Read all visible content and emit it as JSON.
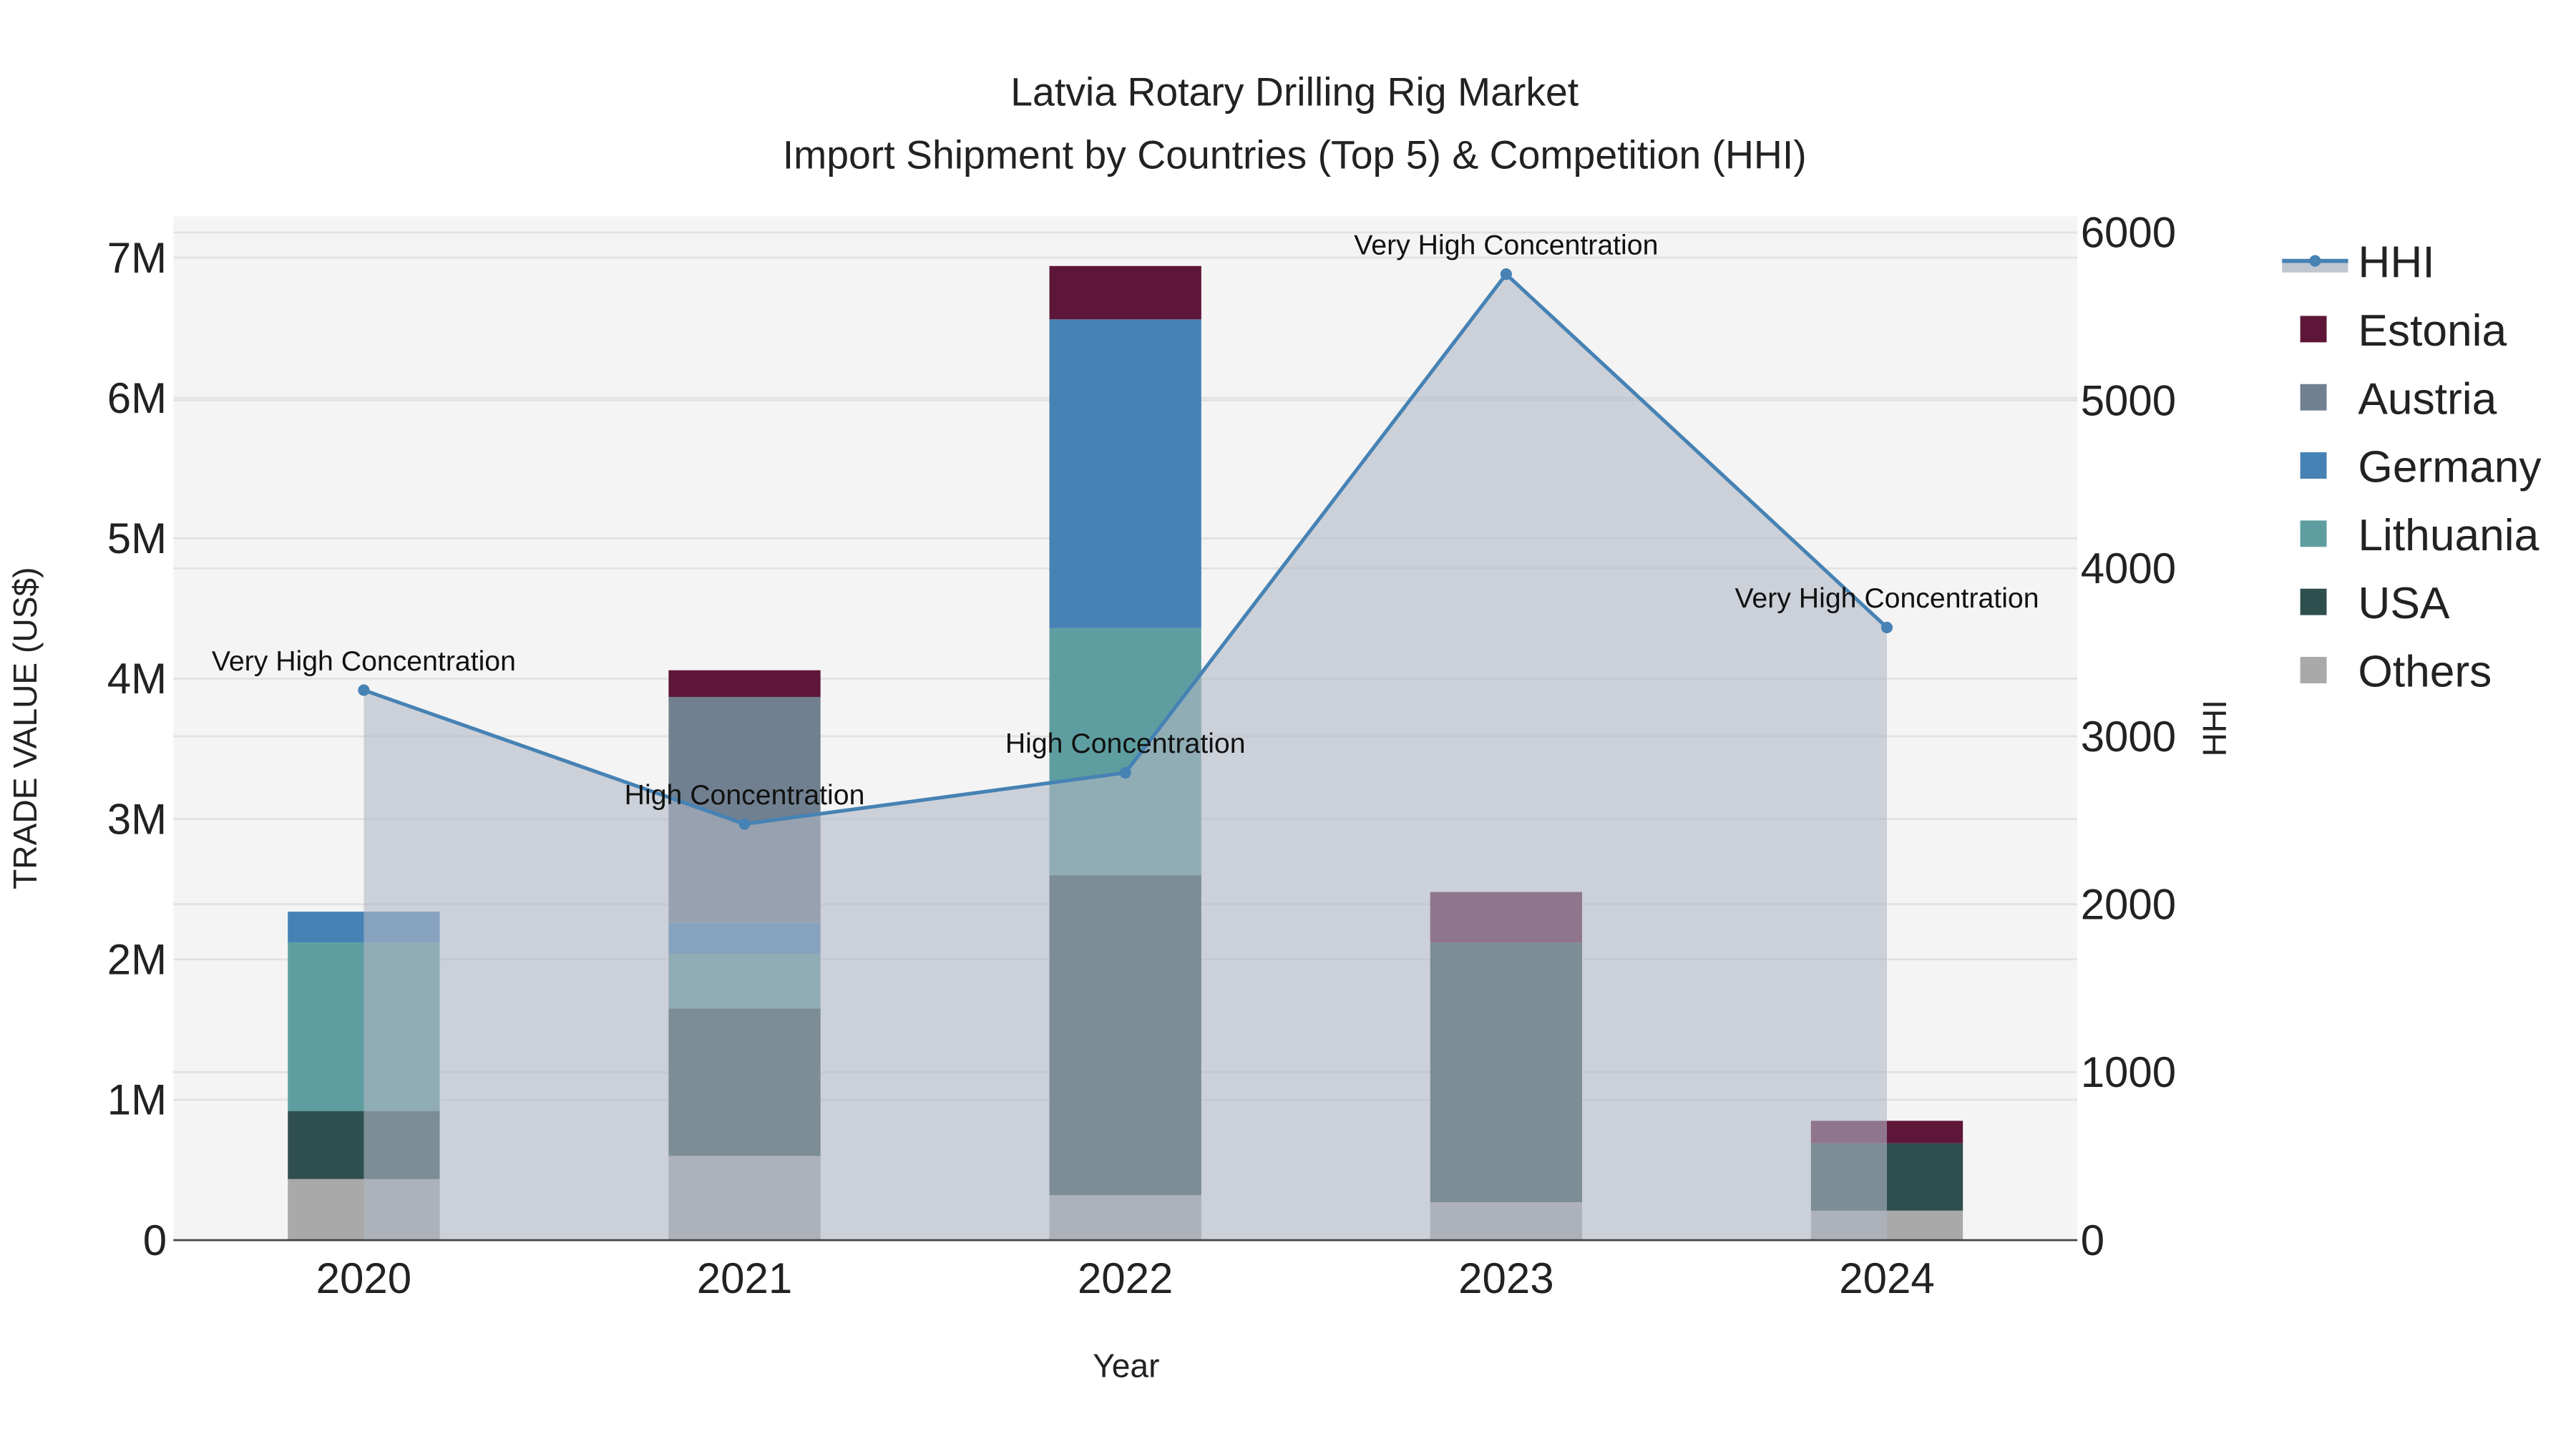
{
  "chart_data": {
    "type": "bar",
    "stacked": true,
    "title": "Latvia Rotary Drilling Rig Market",
    "subtitle": "Import Shipment by Countries (Top 5) & Competition (HHI)",
    "xlabel": "Year",
    "ylabel": "TRADE VALUE (US$)",
    "y2label": "HHI",
    "categories": [
      "2020",
      "2021",
      "2022",
      "2023",
      "2024"
    ],
    "ylim": [
      0,
      7200000
    ],
    "y2lim": [
      0,
      6100
    ],
    "yticks": [
      {
        "v": 0,
        "label": "0"
      },
      {
        "v": 1000000,
        "label": "1M"
      },
      {
        "v": 2000000,
        "label": "2M"
      },
      {
        "v": 3000000,
        "label": "3M"
      },
      {
        "v": 4000000,
        "label": "4M"
      },
      {
        "v": 5000000,
        "label": "5M"
      },
      {
        "v": 6000000,
        "label": "6M"
      },
      {
        "v": 7000000,
        "label": "7M"
      }
    ],
    "y2ticks": [
      {
        "v": 0,
        "label": "0"
      },
      {
        "v": 1000,
        "label": "1000"
      },
      {
        "v": 2000,
        "label": "2000"
      },
      {
        "v": 3000,
        "label": "3000"
      },
      {
        "v": 4000,
        "label": "4000"
      },
      {
        "v": 5000,
        "label": "5000"
      },
      {
        "v": 6000,
        "label": "6000"
      }
    ],
    "grid": true,
    "legend_position": "right",
    "series": [
      {
        "name": "Others",
        "color": "#A9A9A9",
        "values": [
          435000,
          600000,
          320000,
          270000,
          210000
        ]
      },
      {
        "name": "USA",
        "color": "#2F4F4F",
        "values": [
          485000,
          1050000,
          2280000,
          1850000,
          480000
        ]
      },
      {
        "name": "Lithuania",
        "color": "#5F9EA0",
        "values": [
          1200000,
          390000,
          1760000,
          0,
          0
        ]
      },
      {
        "name": "Germany",
        "color": "#4682B4",
        "values": [
          220000,
          220000,
          2200000,
          0,
          0
        ]
      },
      {
        "name": "Austria",
        "color": "#708090",
        "values": [
          0,
          1610000,
          0,
          0,
          0
        ]
      },
      {
        "name": "Estonia",
        "color": "#5E1638",
        "values": [
          0,
          190000,
          380000,
          360000,
          160000
        ]
      }
    ],
    "hhi": {
      "name": "HHI",
      "type": "line+area",
      "color": "#4682B4",
      "fill": "#B0B8C4",
      "values": [
        3275,
        2478,
        2783,
        5752,
        3648
      ],
      "annotations": [
        "Very High Concentration",
        "High Concentration",
        "High Concentration",
        "Very High Concentration",
        "Very High Concentration"
      ]
    },
    "legend": [
      "HHI",
      "Estonia",
      "Austria",
      "Germany",
      "Lithuania",
      "USA",
      "Others"
    ]
  }
}
